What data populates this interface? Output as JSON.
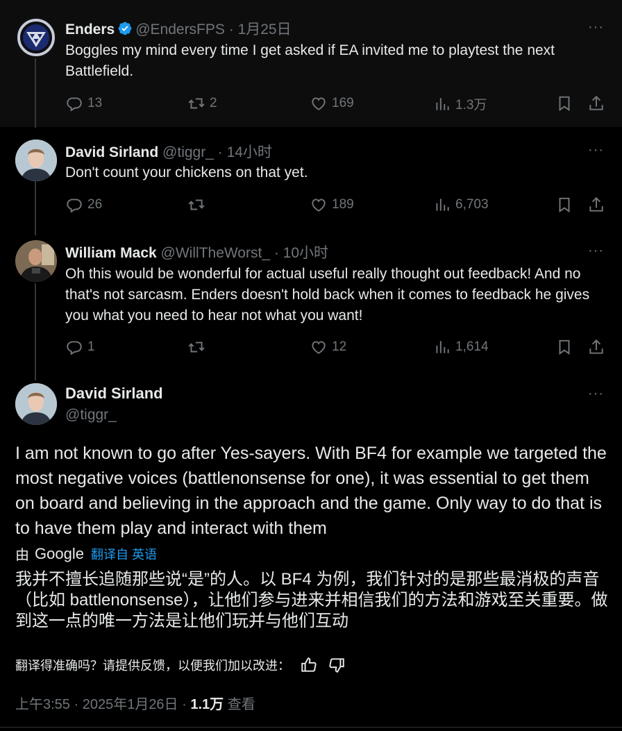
{
  "colors": {
    "background": "#000000",
    "text": "#e7e9ea",
    "muted": "#71767b",
    "link": "#1d9bf0",
    "verified": "#1d9bf0"
  },
  "tweets": [
    {
      "name": "Enders",
      "handle": "@EndersFPS",
      "time": "1月25日",
      "text": "Boggles my mind every time I get asked if EA invited me to playtest the next Battlefield.",
      "replies": "13",
      "retweets": "2",
      "likes": "169",
      "views": "1.3万",
      "verified": true,
      "avatar_icon": "enders-logo-icon"
    },
    {
      "name": "David Sirland",
      "handle": "@tiggr_",
      "time": "14小时",
      "text": "Don't count your chickens on that yet.",
      "replies": "26",
      "retweets": "",
      "likes": "189",
      "views": "6,703",
      "avatar_icon": "david-avatar"
    },
    {
      "name": "William Mack",
      "handle": "@WillTheWorst_",
      "time": "10小时",
      "text": "Oh this would be wonderful for actual useful really thought out feedback! And no that's not sarcasm. Enders doesn't hold back when it comes to feedback he gives you what you need to hear not what you want!",
      "replies": "1",
      "retweets": "",
      "likes": "12",
      "views": "1,614",
      "avatar_icon": "william-avatar"
    }
  ],
  "main": {
    "name": "David Sirland",
    "handle": "@tiggr_",
    "text": "I am not known to go after Yes-sayers. With BF4 for example we targeted the most negative voices (battlenonsense for one), it was essential to get them on board and believing in the approach and the game. Only way to do that is to have them play and interact with them",
    "translated_by_prefix": "由",
    "translated_by_google": "Google",
    "translated_from": "翻译自 英语",
    "translation": "我并不擅长追随那些说“是”的人。以 BF4 为例，我们针对的是那些最消极的声音（比如 battlenonsense），让他们参与进来并相信我们的方法和游戏至关重要。做到这一点的唯一方法是让他们玩并与他们互动",
    "feedback_prompt": "翻译得准确吗？请提供反馈，以便我们加以改进：",
    "time": "上午3:55 · 2025年1月26日 · ",
    "views": "1.1万",
    "views_label": " 查看"
  },
  "more_label": "···",
  "separator": " · "
}
